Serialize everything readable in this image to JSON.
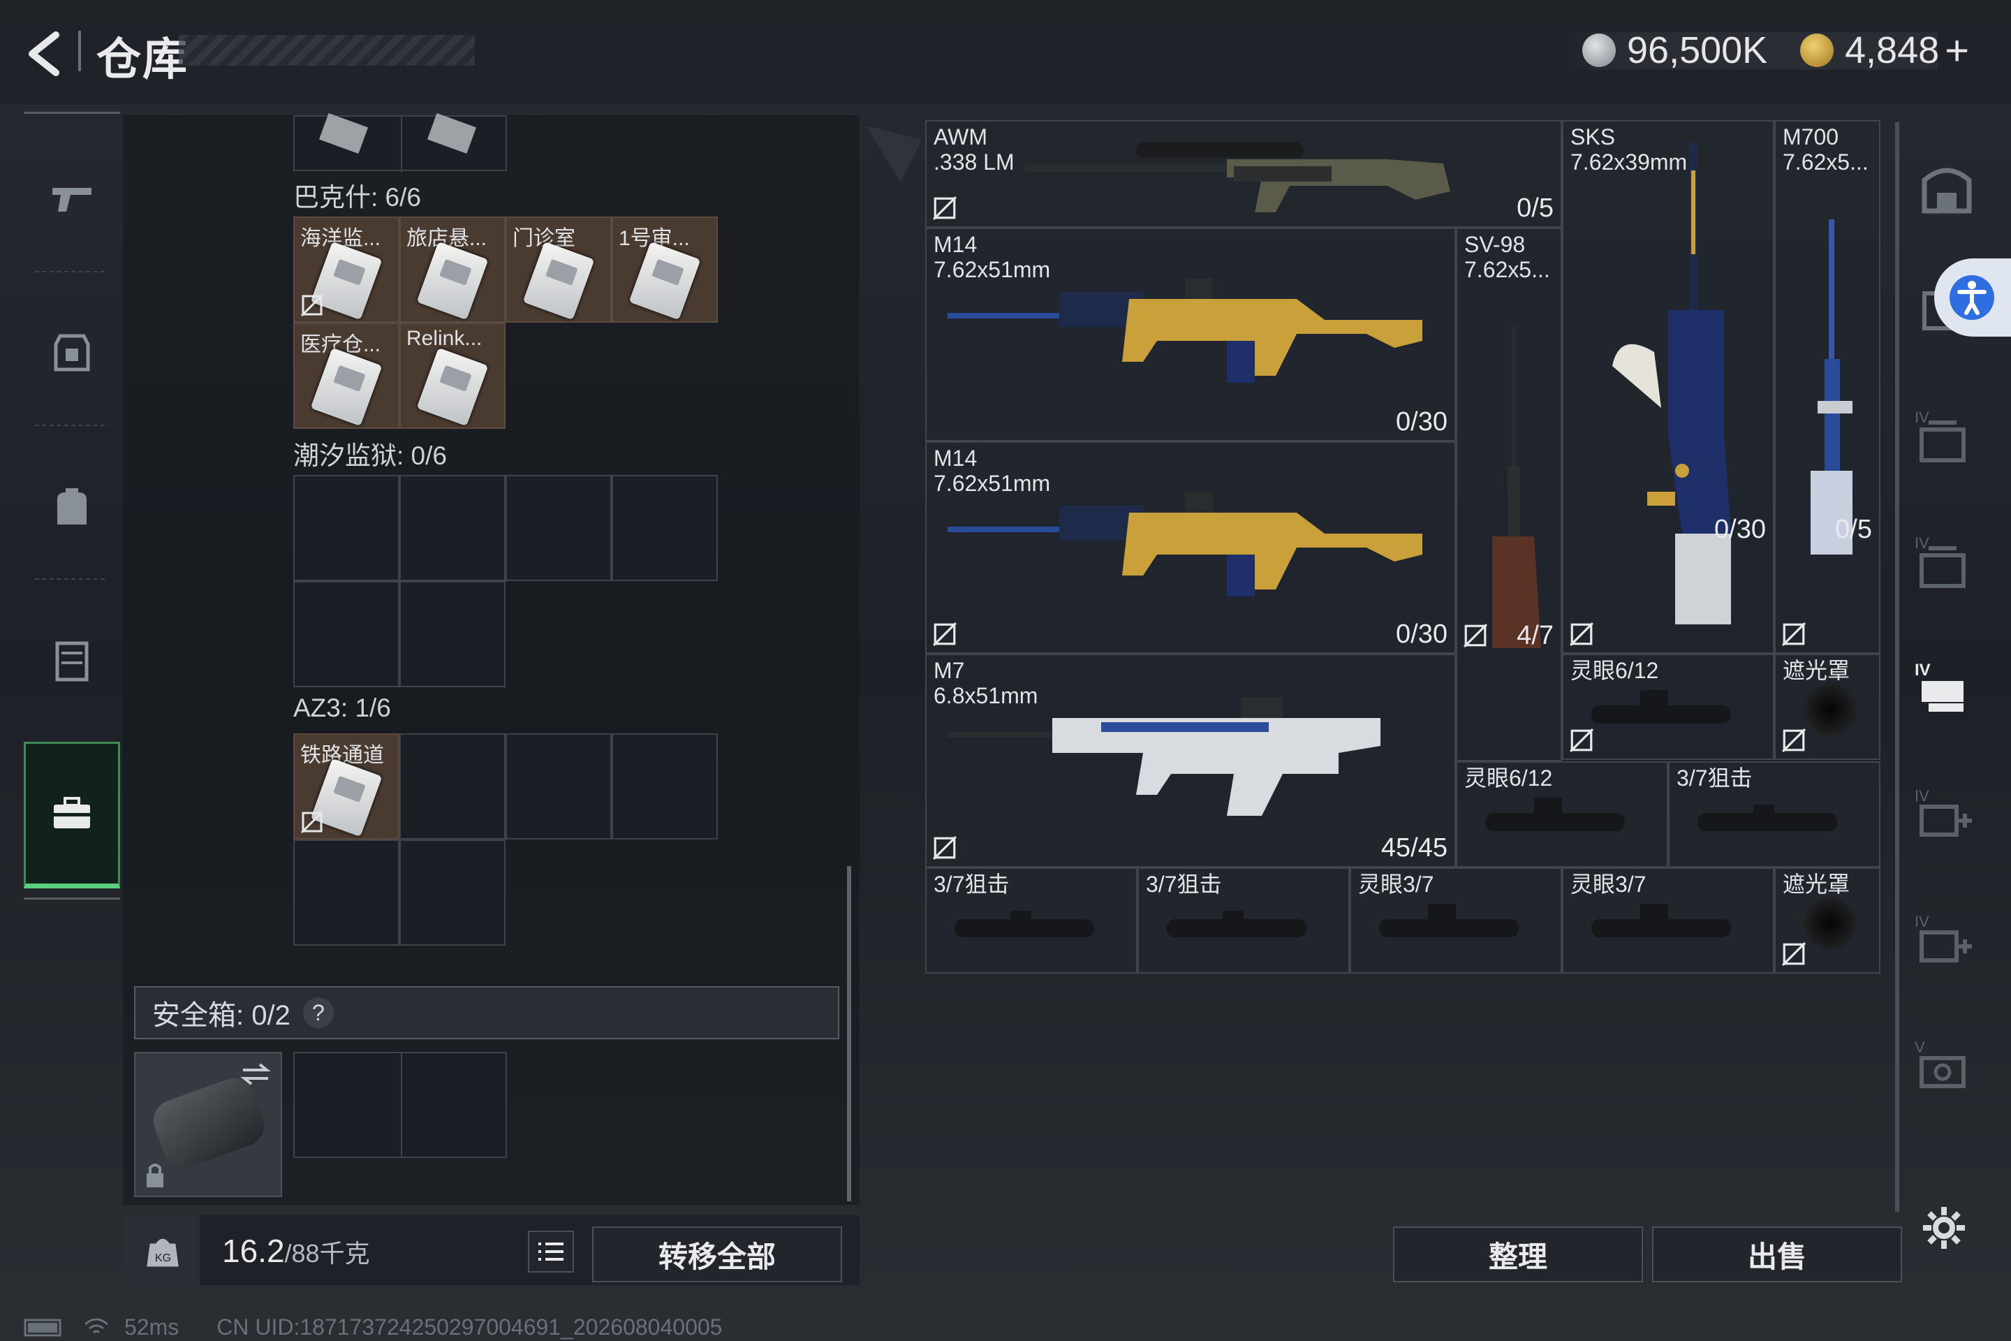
{
  "header": {
    "title": "仓库",
    "currency_1": "96,500K",
    "currency_2": "4,848",
    "add_label": "+"
  },
  "left_nav": {
    "items": [
      "weapon",
      "armor",
      "backpack",
      "rig",
      "case"
    ],
    "active_index": 4
  },
  "storage": {
    "top_cells": [
      {
        "label": ""
      },
      {
        "label": ""
      }
    ],
    "bakshi": {
      "title": "巴克什: 6/6",
      "items": [
        "海洋监...",
        "旅店悬...",
        "门诊室",
        "1号审...",
        "医疗仓...",
        "Relink..."
      ]
    },
    "tidal_prison": {
      "title": "潮汐监狱: 0/6"
    },
    "az3": {
      "title": "AZ3: 1/6",
      "items": [
        "铁路通道"
      ]
    },
    "safebox": {
      "title": "安全箱: 0/2",
      "help": "?"
    }
  },
  "weight": {
    "current": "16.2",
    "max": "/88千克"
  },
  "buttons": {
    "transfer_all": "转移全部",
    "sort": "整理",
    "sell": "出售"
  },
  "weapons": [
    {
      "name": "AWM",
      "ammo": ".338 LM",
      "count": "0/5"
    },
    {
      "name": "SKS",
      "ammo": "7.62x39mm",
      "count": "0/30"
    },
    {
      "name": "M700",
      "ammo": "7.62x5...",
      "count": "0/5"
    },
    {
      "name": "M14",
      "ammo": "7.62x51mm",
      "count": "0/30"
    },
    {
      "name": "SV-98",
      "ammo": "7.62x5...",
      "count": "4/7"
    },
    {
      "name": "M14",
      "ammo": "7.62x51mm",
      "count": "0/30"
    },
    {
      "name": "M7",
      "ammo": "6.8x51mm",
      "count": "45/45"
    }
  ],
  "attachments": [
    {
      "name": "灵眼6/12"
    },
    {
      "name": "遮光罩"
    },
    {
      "name": "灵眼6/12"
    },
    {
      "name": "3/7狙击"
    },
    {
      "name": "3/7狙击"
    },
    {
      "name": "3/7狙击"
    },
    {
      "name": "灵眼3/7"
    },
    {
      "name": "灵眼3/7"
    },
    {
      "name": "遮光罩"
    }
  ],
  "status": {
    "ping": "52ms",
    "uid": "CN UID:18717372425029700469​1_202608040005"
  },
  "colors": {
    "accent_green": "#5ad07a",
    "gold": "#c9a039",
    "item_bg": "#4a3b30"
  }
}
